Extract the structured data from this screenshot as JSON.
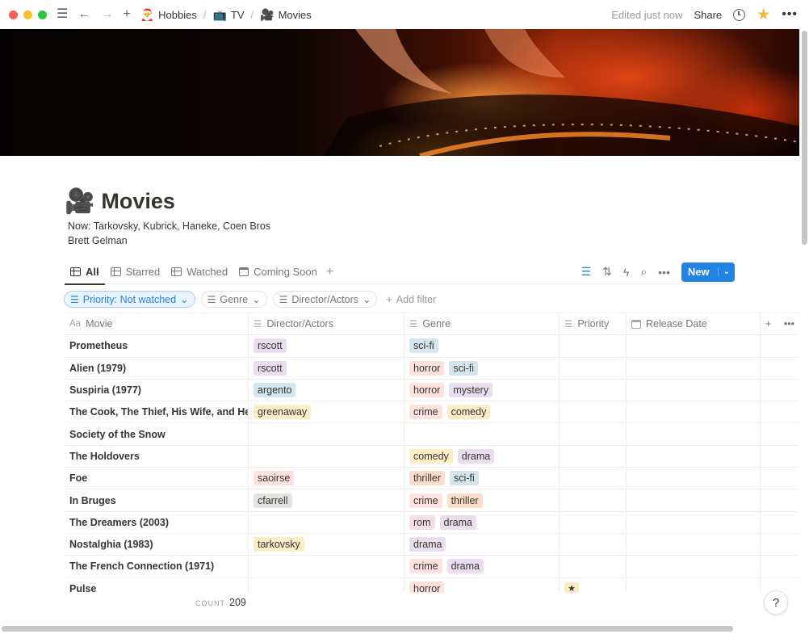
{
  "breadcrumbs": [
    {
      "emoji": "🎅",
      "label": "Hobbies"
    },
    {
      "emoji": "📺",
      "label": "TV"
    },
    {
      "emoji": "🎥",
      "label": "Movies"
    }
  ],
  "topbar": {
    "edited": "Edited just now",
    "share": "Share"
  },
  "page": {
    "emoji": "🎥",
    "title": "Movies",
    "description_lines": [
      "Now: Tarkovsky, Kubrick, Haneke, Coen Bros",
      "Brett Gelman"
    ]
  },
  "views": {
    "tabs": [
      "All",
      "Starred",
      "Watched",
      "Coming Soon"
    ],
    "active_tab": "All",
    "new_button": "New"
  },
  "filters": {
    "active_filter": "Priority: Not watched",
    "chips": [
      "Genre",
      "Director/Actors"
    ],
    "add_filter": "Add filter"
  },
  "table": {
    "columns": {
      "movie": {
        "icon": "Aa",
        "label": "Movie"
      },
      "director": {
        "icon": "☰",
        "label": "Director/Actors"
      },
      "genre": {
        "icon": "☰",
        "label": "Genre"
      },
      "priority": {
        "icon": "☰",
        "label": "Priority"
      },
      "release": {
        "icon": "calendar",
        "label": "Release Date"
      }
    },
    "rows": [
      {
        "movie": "Prometheus",
        "director": [
          "rscott"
        ],
        "genre": [
          "sci-fi"
        ],
        "priority": ""
      },
      {
        "movie": "Alien (1979)",
        "director": [
          "rscott"
        ],
        "genre": [
          "horror",
          "sci-fi"
        ],
        "priority": ""
      },
      {
        "movie": "Suspiria (1977)",
        "director": [
          "argento"
        ],
        "genre": [
          "horror",
          "mystery"
        ],
        "priority": ""
      },
      {
        "movie": "The Cook, The Thief, His Wife, and Her Lover",
        "director": [
          "greenaway"
        ],
        "genre": [
          "crime",
          "comedy"
        ],
        "priority": ""
      },
      {
        "movie": "Society of the Snow",
        "director": [],
        "genre": [],
        "priority": ""
      },
      {
        "movie": "The Holdovers",
        "director": [],
        "genre": [
          "comedy",
          "drama"
        ],
        "priority": ""
      },
      {
        "movie": "Foe",
        "director": [
          "saoirse"
        ],
        "genre": [
          "thriller",
          "sci-fi"
        ],
        "priority": ""
      },
      {
        "movie": "In Bruges",
        "director": [
          "cfarrell"
        ],
        "genre": [
          "crime",
          "thriller"
        ],
        "priority": ""
      },
      {
        "movie": "The Dreamers (2003)",
        "director": [],
        "genre": [
          "rom",
          "drama"
        ],
        "priority": ""
      },
      {
        "movie": "Nostalghia (1983)",
        "director": [
          "tarkovsky"
        ],
        "genre": [
          "drama"
        ],
        "priority": ""
      },
      {
        "movie": "The French Connection (1971)",
        "director": [],
        "genre": [
          "crime",
          "drama"
        ],
        "priority": ""
      },
      {
        "movie": "Pulse",
        "director": [],
        "genre": [
          "horror"
        ],
        "priority": "★"
      }
    ],
    "tag_colors": {
      "rscott": "#e8deee",
      "argento": "#d3e5ef",
      "greenaway": "#fdecc8",
      "saoirse": "#ffe2dd",
      "cfarrell": "#e3e2e0",
      "tarkovsky": "#fdecc8",
      "sci-fi": "#d3e5ef",
      "horror": "#ffe2dd",
      "mystery": "#e8deee",
      "crime": "#ffe2dd",
      "comedy": "#fdecc8",
      "drama": "#e8deee",
      "thriller": "#fadec9",
      "rom": "#f5e0e9"
    }
  },
  "footer": {
    "count_label": "COUNT",
    "count_value": "209"
  }
}
